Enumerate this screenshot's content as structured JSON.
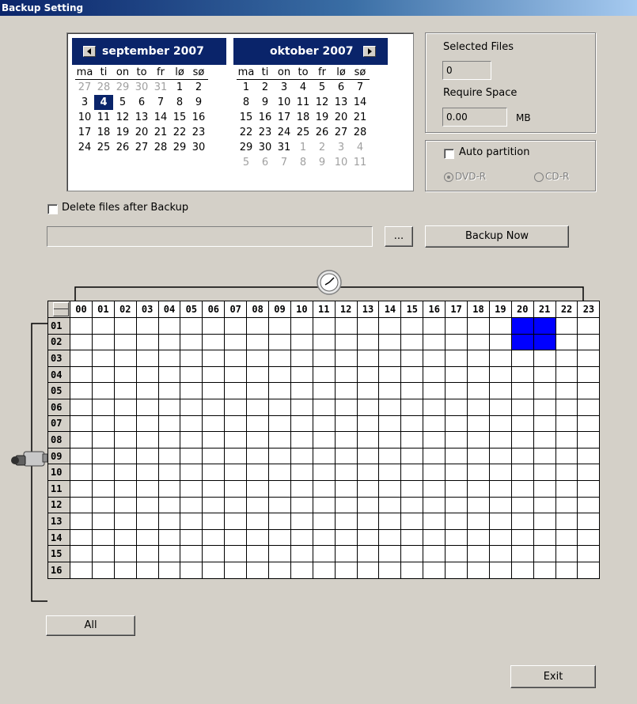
{
  "window": {
    "title": "Backup Setting"
  },
  "calendar": {
    "weekdays": [
      "ma",
      "ti",
      "on",
      "to",
      "fr",
      "lø",
      "sø"
    ],
    "months": [
      {
        "title": "september 2007",
        "weeks": [
          [
            "27",
            "28",
            "29",
            "30",
            "31",
            "1",
            "2"
          ],
          [
            "3",
            "4",
            "5",
            "6",
            "7",
            "8",
            "9"
          ],
          [
            "10",
            "11",
            "12",
            "13",
            "14",
            "15",
            "16"
          ],
          [
            "17",
            "18",
            "19",
            "20",
            "21",
            "22",
            "23"
          ],
          [
            "24",
            "25",
            "26",
            "27",
            "28",
            "29",
            "30"
          ]
        ],
        "other_month": [
          [
            true,
            true,
            true,
            true,
            true,
            false,
            false
          ],
          [
            false,
            false,
            false,
            false,
            false,
            false,
            false
          ],
          [
            false,
            false,
            false,
            false,
            false,
            false,
            false
          ],
          [
            false,
            false,
            false,
            false,
            false,
            false,
            false
          ],
          [
            false,
            false,
            false,
            false,
            false,
            false,
            false
          ]
        ],
        "selected_day": "4"
      },
      {
        "title": "oktober 2007",
        "weeks": [
          [
            "1",
            "2",
            "3",
            "4",
            "5",
            "6",
            "7"
          ],
          [
            "8",
            "9",
            "10",
            "11",
            "12",
            "13",
            "14"
          ],
          [
            "15",
            "16",
            "17",
            "18",
            "19",
            "20",
            "21"
          ],
          [
            "22",
            "23",
            "24",
            "25",
            "26",
            "27",
            "28"
          ],
          [
            "29",
            "30",
            "31",
            "1",
            "2",
            "3",
            "4"
          ],
          [
            "5",
            "6",
            "7",
            "8",
            "9",
            "10",
            "11"
          ]
        ],
        "other_month": [
          [
            false,
            false,
            false,
            false,
            false,
            false,
            false
          ],
          [
            false,
            false,
            false,
            false,
            false,
            false,
            false
          ],
          [
            false,
            false,
            false,
            false,
            false,
            false,
            false
          ],
          [
            false,
            false,
            false,
            false,
            false,
            false,
            false
          ],
          [
            false,
            false,
            false,
            true,
            true,
            true,
            true
          ],
          [
            true,
            true,
            true,
            true,
            true,
            true,
            true
          ]
        ],
        "selected_day": ""
      }
    ]
  },
  "summary": {
    "selected_files_label": "Selected Files",
    "selected_files_value": "0",
    "require_space_label": "Require Space",
    "require_space_value": "0.00",
    "require_space_unit": "MB"
  },
  "partition": {
    "auto_label": "Auto partition",
    "auto_checked": false,
    "dvd_label": "DVD-R",
    "cd_label": "CD-R",
    "selected": "DVD-R"
  },
  "options": {
    "delete_after_label": "Delete files after Backup",
    "delete_after_checked": false
  },
  "path": {
    "value": "",
    "browse_label": "..."
  },
  "buttons": {
    "backup_now": "Backup Now",
    "all": "All",
    "exit": "Exit"
  },
  "schedule": {
    "hours": [
      "00",
      "01",
      "02",
      "03",
      "04",
      "05",
      "06",
      "07",
      "08",
      "09",
      "10",
      "11",
      "12",
      "13",
      "14",
      "15",
      "16",
      "17",
      "18",
      "19",
      "20",
      "21",
      "22",
      "23"
    ],
    "channels": [
      "01",
      "02",
      "03",
      "04",
      "05",
      "06",
      "07",
      "08",
      "09",
      "10",
      "11",
      "12",
      "13",
      "14",
      "15",
      "16"
    ],
    "selected": [
      {
        "channel": "01",
        "hours": [
          "20",
          "21"
        ]
      },
      {
        "channel": "02",
        "hours": [
          "20",
          "21"
        ]
      }
    ]
  },
  "icons": {
    "clock": "clock-icon",
    "camera": "camera-icon"
  },
  "colors": {
    "title_bar": "#0a246a",
    "selected_cell": "#0000ff",
    "window_bg": "#d4d0c8"
  }
}
